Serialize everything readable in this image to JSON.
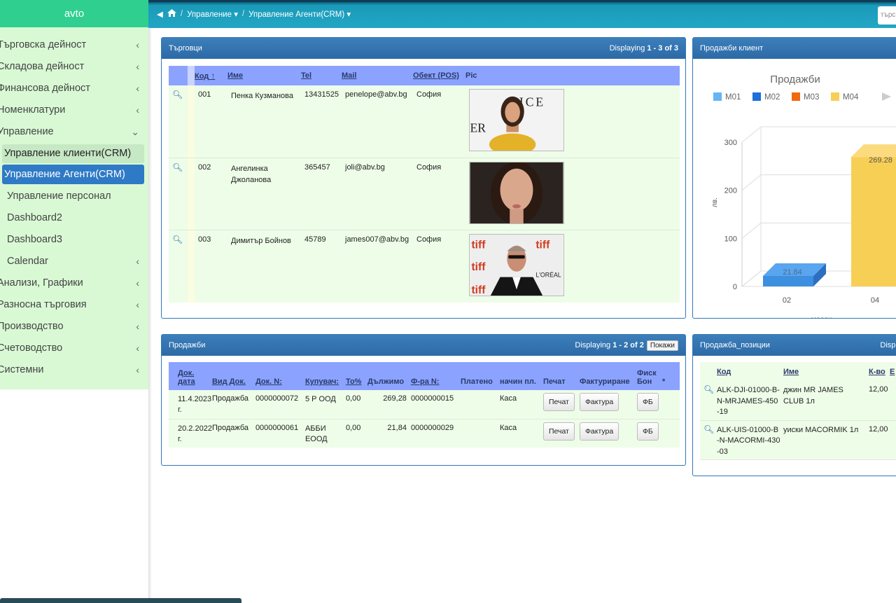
{
  "sidebar": {
    "brand": "avto",
    "items": [
      {
        "label": "Търговска дейност",
        "chev": "‹",
        "type": "top"
      },
      {
        "label": "Складова дейност",
        "chev": "‹",
        "type": "top"
      },
      {
        "label": "Финансова дейност",
        "chev": "‹",
        "type": "top"
      },
      {
        "label": "Номенклатури",
        "chev": "‹",
        "type": "top"
      },
      {
        "label": "Управление",
        "chev": "⌄",
        "type": "top"
      },
      {
        "label": "Управление клиенти(CRM)",
        "chev": "",
        "type": "active-light"
      },
      {
        "label": "Управление Агенти(CRM)",
        "chev": "",
        "type": "active"
      },
      {
        "label": "Управление персонал",
        "chev": "",
        "type": "sub"
      },
      {
        "label": "Dashboard2",
        "chev": "",
        "type": "sub"
      },
      {
        "label": "Dashboard3",
        "chev": "",
        "type": "sub"
      },
      {
        "label": "Calendar",
        "chev": "‹",
        "type": "sub"
      },
      {
        "label": "Анализи, Графики",
        "chev": "‹",
        "type": "top"
      },
      {
        "label": "Разносна търговия",
        "chev": "‹",
        "type": "top"
      },
      {
        "label": "Производство",
        "chev": "‹",
        "type": "top"
      },
      {
        "label": "Счетоводство",
        "chev": "‹",
        "type": "top"
      },
      {
        "label": "Системни",
        "chev": "‹",
        "type": "top"
      }
    ]
  },
  "topbar": {
    "crumb1": "Управление",
    "crumb2": "Управление Агенти(CRM)",
    "search_placeholder": "търс"
  },
  "traders": {
    "title": "Търговци",
    "displaying_prefix": "Displaying ",
    "displaying_range": "1 - 3 of 3",
    "columns": [
      "Код",
      "Име",
      "Tel",
      "Mail",
      "Обект (POS)",
      "Pic"
    ],
    "rows": [
      {
        "code": "001",
        "name": "Пенка Кузманова",
        "tel": "13431525",
        "mail": "penelope@abv.bg",
        "pos": "София"
      },
      {
        "code": "002",
        "name": "Ангелинка Джоланова",
        "tel": "365457",
        "mail": "joli@abv.bg",
        "pos": "София"
      },
      {
        "code": "003",
        "name": "Димитър Бойнов",
        "tel": "45789",
        "mail": "james007@abv.bg",
        "pos": "София"
      }
    ]
  },
  "sales_client": {
    "title": "Продажби клиент"
  },
  "chart_data": {
    "type": "bar",
    "title": "Продажби",
    "legend": [
      "M01",
      "M02",
      "M03",
      "M04"
    ],
    "legend_colors": [
      "#64b5f6",
      "#1e6fd9",
      "#f06a10",
      "#f8cf55"
    ],
    "categories": [
      "02",
      "04"
    ],
    "values": [
      21.84,
      269.28
    ],
    "bar_colors": [
      "#3d8fe0",
      "#f8cf55"
    ],
    "value_labels": [
      "21.84",
      "269.28"
    ],
    "ylabel": "лв.",
    "xlabel": "месец",
    "yticks": [
      "0",
      "100",
      "200",
      "300"
    ],
    "ylim": [
      0,
      300
    ]
  },
  "sales": {
    "title": "Продажби",
    "displaying_prefix": "Displaying ",
    "displaying_range": "1 - 2 of 2",
    "show_btn": "Покажи",
    "columns": [
      "Док. дата",
      "Вид Док.",
      "Док. N:",
      "Купувач:",
      "То%",
      "Дължимо",
      "Ф-ра N:",
      "Платено",
      "начин пл.",
      "Печат",
      "Фактуриране",
      "Фиск Бон",
      "*"
    ],
    "rows": [
      {
        "date": "11.4.2023 г.",
        "type": "Продажба",
        "doc": "0000000072",
        "buyer": "5 Р ООД",
        "pct": "0,00",
        "due": "269,28",
        "inv": "0000000015",
        "paid": "",
        "method": "Каса",
        "print": "Печат",
        "invoice": "Фактура",
        "fisc": "ФБ"
      },
      {
        "date": "20.2.2022 г.",
        "type": "Продажба",
        "doc": "0000000061",
        "buyer": "АББИ ЕООД",
        "pct": "0,00",
        "due": "21,84",
        "inv": "0000000029",
        "paid": "",
        "method": "Каса",
        "print": "Печат",
        "invoice": "Фактура",
        "fisc": "ФБ"
      }
    ]
  },
  "positions": {
    "title": "Продажба_позиции",
    "displaying": "Displa",
    "columns": [
      "Код",
      "Име",
      "К-во",
      "Е"
    ],
    "rows": [
      {
        "code": "ALK-DJI-01000-B-N-MRJAMES-450-19",
        "name": "джин MR JAMES CLUB 1л",
        "qty": "12,00"
      },
      {
        "code": "ALK-UIS-01000-B-N-MACORMI-430-03",
        "name": "уиски MACORMIK 1л",
        "qty": "12,00"
      }
    ]
  }
}
